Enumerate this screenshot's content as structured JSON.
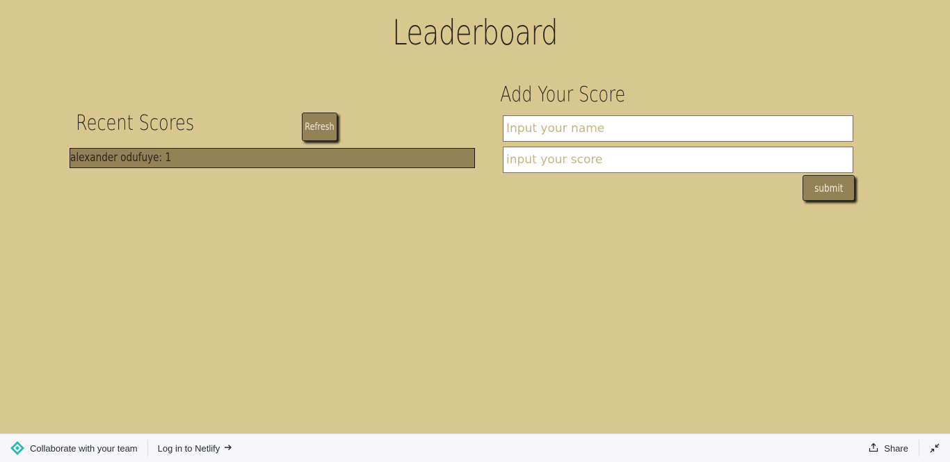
{
  "page": {
    "title": "Leaderboard"
  },
  "recent": {
    "heading": "Recent Scores",
    "refresh_label": "Refresh",
    "scores": [
      "alexander odufuye: 1"
    ]
  },
  "add_score": {
    "heading": "Add Your Score",
    "name_placeholder": "Input your name",
    "score_placeholder": "input your score",
    "submit_label": "submit"
  },
  "netlify_bar": {
    "logo_icon": "netlify-logo-icon",
    "collaborate_label": "Collaborate with your team",
    "login_label": "Log in to Netlify",
    "login_icon": "arrow-right-icon",
    "share_label": "Share",
    "share_icon": "share-icon",
    "collapse_icon": "collapse-icon"
  },
  "colors": {
    "background": "#d8c890",
    "button": "#948257",
    "list_item": "#948257",
    "text": "#2a261c"
  }
}
